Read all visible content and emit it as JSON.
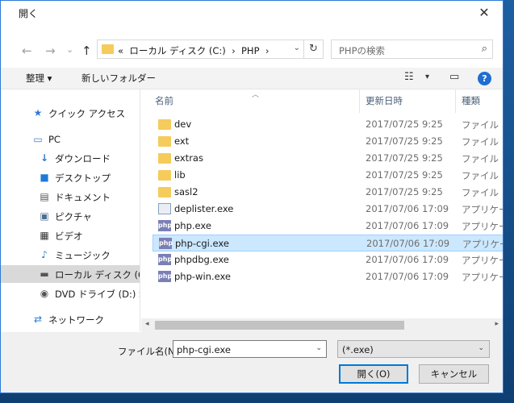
{
  "window": {
    "title": "開く",
    "close_glyph": "✕"
  },
  "nav_buttons": {
    "back": "←",
    "forward": "→",
    "dropdown": "⌄",
    "up": "↑"
  },
  "address": {
    "breadcrumb_sep": "«",
    "drive": "ローカル ディスク (C:)",
    "arrow1": "›",
    "folder": "PHP",
    "arrow2": "›",
    "dropdown": "⌄",
    "refresh": "↻"
  },
  "search": {
    "placeholder": "PHPの検索",
    "icon": "⌕"
  },
  "toolbar": {
    "organize_label": "整理 ▾",
    "new_folder_label": "新しいフォルダー",
    "view_icon": "☷",
    "view_dropdown": "▾",
    "preview_icon": "▭",
    "help_label": "?"
  },
  "sidebar": {
    "items": [
      {
        "label": "クイック アクセス",
        "icon": "★"
      },
      {
        "label": "PC",
        "icon": "▭"
      },
      {
        "label": "ダウンロード",
        "icon": "↓"
      },
      {
        "label": "デスクトップ",
        "icon": "■"
      },
      {
        "label": "ドキュメント",
        "icon": "▤"
      },
      {
        "label": "ピクチャ",
        "icon": "▣"
      },
      {
        "label": "ビデオ",
        "icon": "▦"
      },
      {
        "label": "ミュージック",
        "icon": "♪"
      },
      {
        "label": "ローカル ディスク (C:)",
        "icon": "▬"
      },
      {
        "label": "DVD ドライブ (D:) SSS",
        "icon": "◉"
      },
      {
        "label": "ネットワーク",
        "icon": "⇄"
      }
    ]
  },
  "columns": {
    "name": "名前",
    "date": "更新日時",
    "type": "種類",
    "sort_arrow": "︿"
  },
  "files": [
    {
      "name": "dev",
      "date": "2017/07/25 9:25",
      "type": "ファイル フォルダー",
      "kind": "folder",
      "selected": false
    },
    {
      "name": "ext",
      "date": "2017/07/25 9:25",
      "type": "ファイル フォルダー",
      "kind": "folder",
      "selected": false
    },
    {
      "name": "extras",
      "date": "2017/07/25 9:25",
      "type": "ファイル フォルダー",
      "kind": "folder",
      "selected": false
    },
    {
      "name": "lib",
      "date": "2017/07/25 9:25",
      "type": "ファイル フォルダー",
      "kind": "folder",
      "selected": false
    },
    {
      "name": "sasl2",
      "date": "2017/07/25 9:25",
      "type": "ファイル フォルダー",
      "kind": "folder",
      "selected": false
    },
    {
      "name": "deplister.exe",
      "date": "2017/07/06 17:09",
      "type": "アプリケーション",
      "kind": "exe",
      "selected": false
    },
    {
      "name": "php.exe",
      "date": "2017/07/06 17:09",
      "type": "アプリケーション",
      "kind": "php",
      "selected": false
    },
    {
      "name": "php-cgi.exe",
      "date": "2017/07/06 17:09",
      "type": "アプリケーション",
      "kind": "php",
      "selected": true
    },
    {
      "name": "phpdbg.exe",
      "date": "2017/07/06 17:09",
      "type": "アプリケーション",
      "kind": "php",
      "selected": false
    },
    {
      "name": "php-win.exe",
      "date": "2017/07/06 17:09",
      "type": "アプリケーション",
      "kind": "php",
      "selected": false
    }
  ],
  "php_icon_text": "php",
  "scrollbar": {
    "left": "◂",
    "right": "▸"
  },
  "bottom": {
    "filename_label": "ファイル名(N):",
    "filename_value": "php-cgi.exe",
    "filetype_value": "(*.exe)",
    "dropdown": "⌄",
    "open_label": "開く(O)",
    "cancel_label": "キャンセル"
  }
}
